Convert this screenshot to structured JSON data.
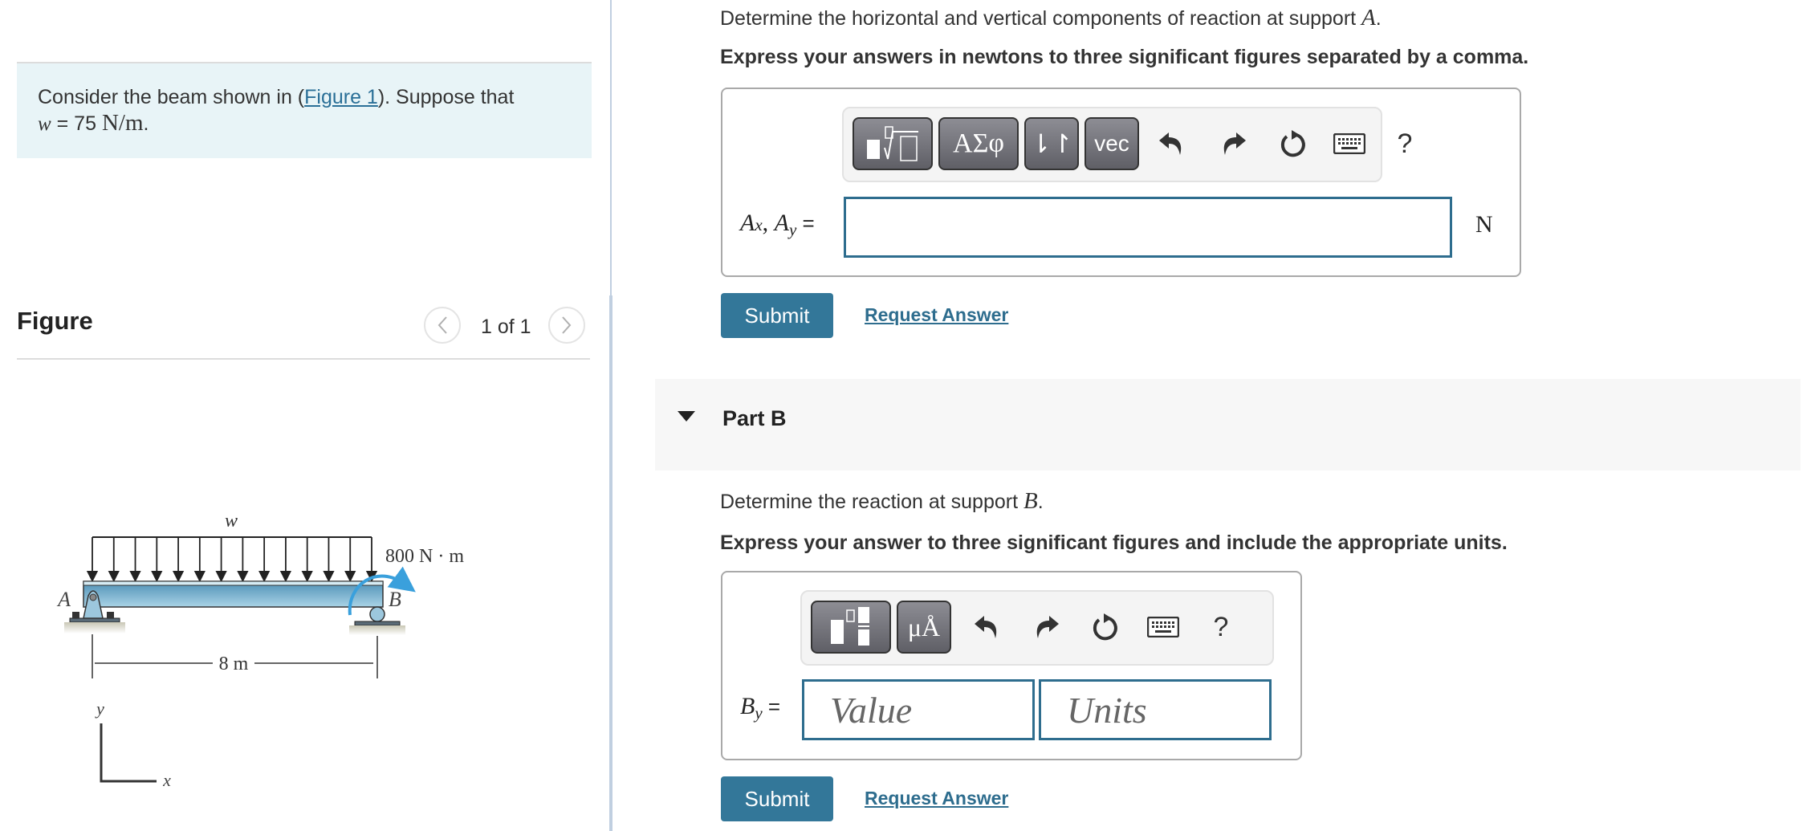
{
  "intro": {
    "text_before": "Consider the beam shown in (",
    "figure_link": "Figure 1",
    "text_after": "). Suppose that",
    "var": "w",
    "equals": " = 75 ",
    "unit": "N/m",
    "period": "."
  },
  "figure_panel": {
    "title": "Figure",
    "counter": "1 of 1",
    "prev_icon": "chevron-left",
    "next_icon": "chevron-right"
  },
  "figure": {
    "load_label": "w",
    "moment_label": "800 N · m",
    "support_a_label": "A",
    "support_b_label": "B",
    "span_label": "8 m",
    "axis_y": "y",
    "axis_x": "x",
    "colors": {
      "beam": "#8fc3dc",
      "moment_arrow": "#3aa0dc"
    }
  },
  "part_a": {
    "prompt": "Determine the horizontal and vertical components of reaction at support ",
    "prompt_var": "A",
    "prompt_end": ".",
    "instruction": "Express your answers in newtons to three significant figures separated by a comma.",
    "toolbar": {
      "buttons": [
        {
          "name": "templates",
          "icon": "fraction-root-icon"
        },
        {
          "name": "greek",
          "label": "ΑΣφ"
        },
        {
          "name": "sort",
          "label": "⇂↾"
        },
        {
          "name": "vector",
          "label": "vec"
        }
      ],
      "icons": [
        "undo-icon",
        "redo-icon",
        "reset-icon",
        "keyboard-icon",
        "help-icon"
      ],
      "help_label": "?"
    },
    "equation_label": "Ax, Ay =",
    "input_value": "",
    "unit": "N",
    "submit_label": "Submit",
    "request_label": "Request Answer"
  },
  "part_b": {
    "header": "Part B",
    "prompt": "Determine the reaction at support ",
    "prompt_var": "B",
    "prompt_end": ".",
    "instruction": "Express your answer to three significant figures and include the appropriate units.",
    "toolbar": {
      "buttons": [
        {
          "name": "templates",
          "icon": "fraction-template-icon"
        },
        {
          "name": "units",
          "label": "μÅ"
        }
      ],
      "icons": [
        "undo-icon",
        "redo-icon",
        "reset-icon",
        "keyboard-icon",
        "help-icon"
      ],
      "help_label": "?"
    },
    "equation_label": "By =",
    "value_placeholder": "Value",
    "units_placeholder": "Units",
    "submit_label": "Submit",
    "request_label": "Request Answer"
  }
}
